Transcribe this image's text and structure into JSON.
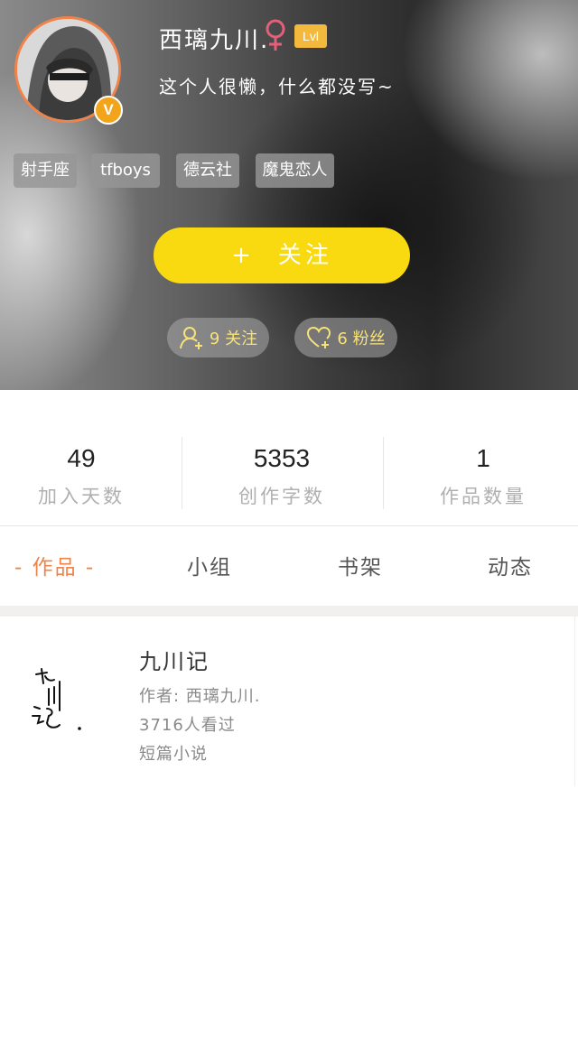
{
  "profile": {
    "username": "西璃九川.",
    "level": "Lvl",
    "bio": "这个人很懒，什么都没写~",
    "verified_badge": "V",
    "tags": [
      "射手座",
      "tfboys",
      "德云社",
      "魔鬼恋人"
    ],
    "follow_label": "关注",
    "follow_plus": "+",
    "following_count_label": "9 关注",
    "followers_count_label": "6 粉丝"
  },
  "stats": [
    {
      "value": "49",
      "label": "加入天数"
    },
    {
      "value": "5353",
      "label": "创作字数"
    },
    {
      "value": "1",
      "label": "作品数量"
    }
  ],
  "tabs": [
    {
      "label": "- 作品 -",
      "active": true
    },
    {
      "label": "小组",
      "active": false
    },
    {
      "label": "书架",
      "active": false
    },
    {
      "label": "动态",
      "active": false
    }
  ],
  "works": [
    {
      "title": "九川记",
      "author": "作者: 西璃九川.",
      "views": "3716人看过",
      "category": "短篇小说"
    }
  ],
  "colors": {
    "accent_orange": "#f0834a",
    "follow_yellow": "#f9d910",
    "gender_pink": "#e2607a",
    "verified_gold": "#f2a51a"
  },
  "icons": {
    "gender": "female-icon",
    "following": "user-add-icon",
    "followers": "heart-add-icon"
  }
}
